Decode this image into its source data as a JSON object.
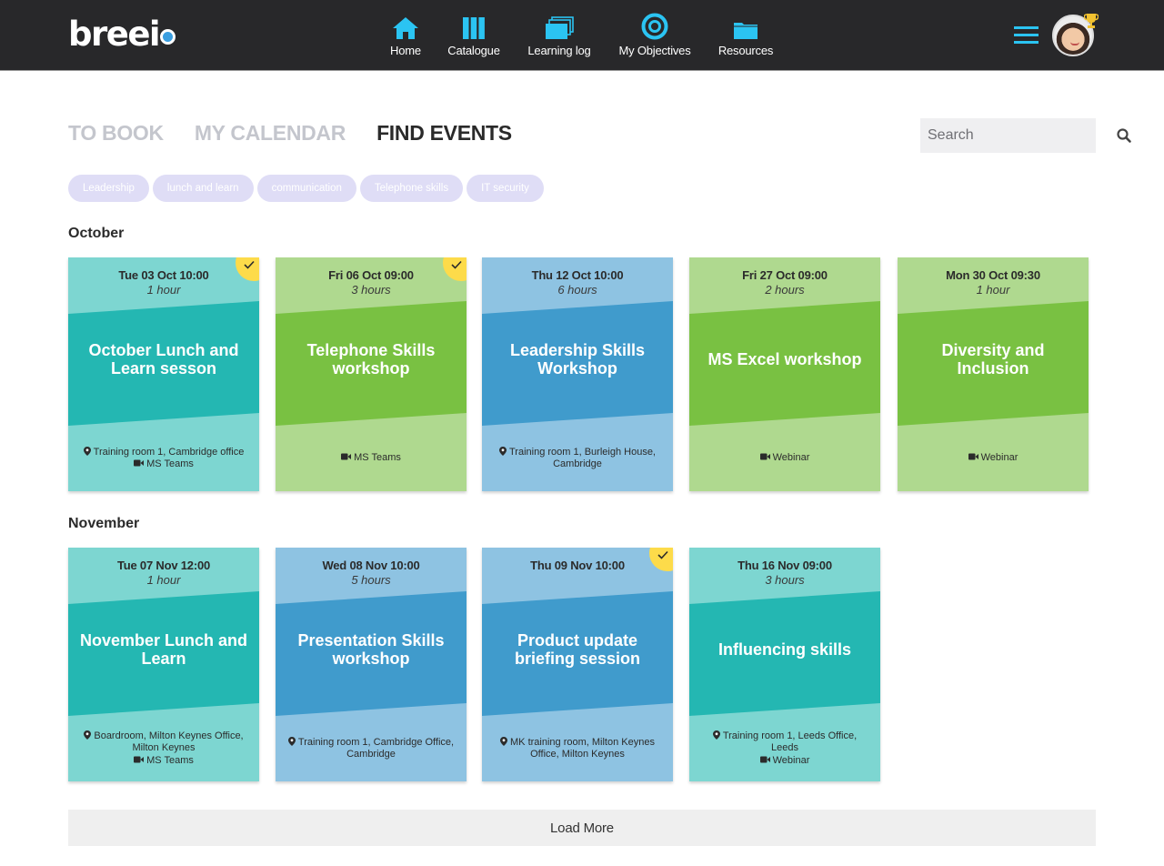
{
  "header": {
    "logo_text": "breeio",
    "nav": [
      {
        "label": "Home",
        "icon": "home-icon"
      },
      {
        "label": "Catalogue",
        "icon": "catalogue-icon"
      },
      {
        "label": "Learning log",
        "icon": "learning-log-icon"
      },
      {
        "label": "My Objectives",
        "icon": "target-icon"
      },
      {
        "label": "Resources",
        "icon": "folder-icon"
      }
    ],
    "menu_icon": "hamburger-menu-icon",
    "avatar_icon": "user-avatar",
    "badge_icon": "trophy-icon",
    "accent_color": "#2bc4f2"
  },
  "tabs": [
    {
      "label": "TO BOOK",
      "active": false
    },
    {
      "label": "MY CALENDAR",
      "active": false
    },
    {
      "label": "FIND EVENTS",
      "active": true
    }
  ],
  "search": {
    "placeholder": "Search",
    "value": "",
    "icon": "search-icon"
  },
  "tags": [
    "Leadership",
    "lunch and learn",
    "communication",
    "Telephone skills",
    "IT security"
  ],
  "months": [
    {
      "name": "October",
      "events": [
        {
          "date": "Tue 03 Oct 10:00",
          "duration": "1 hour",
          "title": "October Lunch and Learn sesson",
          "location": "Training room 1, Cambridge office",
          "online": "MS Teams",
          "booked": true,
          "color": "teal"
        },
        {
          "date": "Fri 06 Oct 09:00",
          "duration": "3 hours",
          "title": "Telephone Skills workshop",
          "location": "",
          "online": "MS Teams",
          "booked": true,
          "color": "green"
        },
        {
          "date": "Thu 12 Oct 10:00",
          "duration": "6 hours",
          "title": "Leadership Skills Workshop",
          "location": "Training room 1, Burleigh House, Cambridge",
          "online": "",
          "booked": false,
          "color": "blue"
        },
        {
          "date": "Fri 27 Oct 09:00",
          "duration": "2 hours",
          "title": "MS Excel workshop",
          "location": "",
          "online": "Webinar",
          "booked": false,
          "color": "green"
        },
        {
          "date": "Mon 30 Oct 09:30",
          "duration": "1 hour",
          "title": "Diversity and Inclusion",
          "location": "",
          "online": "Webinar",
          "booked": false,
          "color": "green"
        }
      ]
    },
    {
      "name": "November",
      "events": [
        {
          "date": "Tue 07 Nov 12:00",
          "duration": "1 hour",
          "title": "November Lunch and Learn",
          "location": "Boardroom, Milton Keynes Office, Milton Keynes",
          "online": "MS Teams",
          "booked": false,
          "color": "teal"
        },
        {
          "date": "Wed 08 Nov 10:00",
          "duration": "5 hours",
          "title": "Presentation Skills workshop",
          "location": "Training room 1, Cambridge Office, Cambridge",
          "online": "",
          "booked": false,
          "color": "blue"
        },
        {
          "date": "Thu 09 Nov 10:00",
          "duration": "",
          "title": "Product update briefing session",
          "location": "MK training room, Milton Keynes Office, Milton Keynes",
          "online": "",
          "booked": true,
          "color": "blue"
        },
        {
          "date": "Thu 16 Nov 09:00",
          "duration": "3 hours",
          "title": "Influencing skills",
          "location": "Training room 1, Leeds Office, Leeds",
          "online": "Webinar",
          "booked": false,
          "color": "teal"
        }
      ]
    }
  ],
  "colors": {
    "teal": {
      "light": "#7dd6d1",
      "dark": "#24b7b2"
    },
    "green": {
      "light": "#afd98f",
      "dark": "#79c142"
    },
    "blue": {
      "light": "#8ec3e2",
      "dark": "#409bcc"
    },
    "booked_badge": "#fddb4a"
  },
  "load_more_label": "Load More"
}
